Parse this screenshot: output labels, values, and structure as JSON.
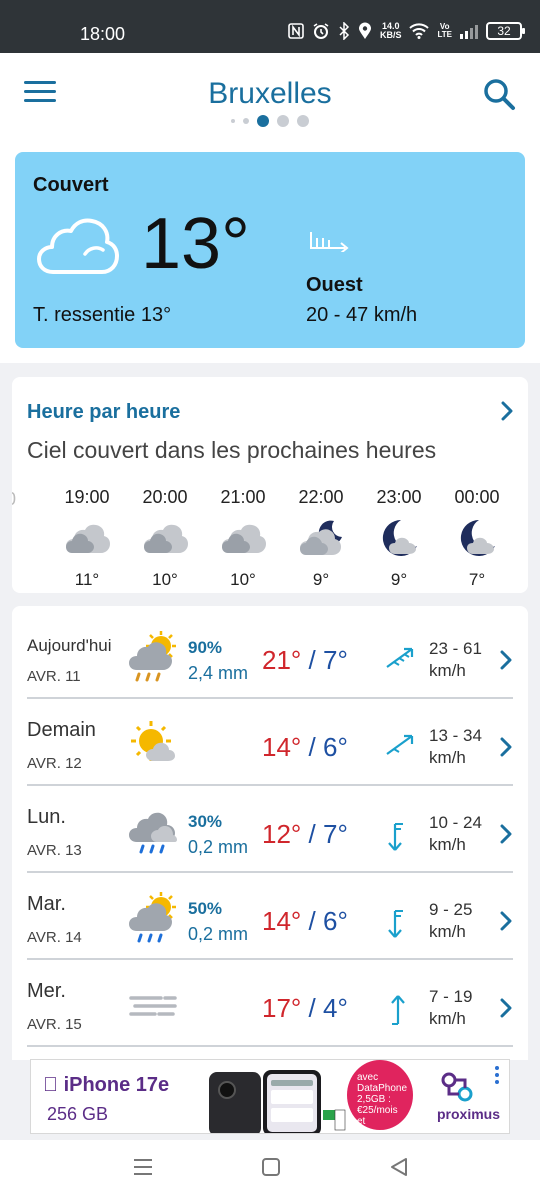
{
  "status_bar": {
    "time": "18:00",
    "icons": [
      "nfc-icon",
      "alarm-icon",
      "bluetooth-icon",
      "location-icon",
      "wifi-icon",
      "signal-icon"
    ],
    "speed_value": "14.0",
    "speed_unit": "KB/S",
    "volte_top": "Vo",
    "volte_bottom": "LTE",
    "battery": "32"
  },
  "header": {
    "city": "Bruxelles",
    "page_dots": 5,
    "active_dot": 2
  },
  "current": {
    "condition": "Couvert",
    "temperature": "13°",
    "feels_like": "T. ressentie 13°",
    "wind_direction": "Ouest",
    "wind_speed": "20 - 47 km/h",
    "card_color": "#82d2f7"
  },
  "hourly": {
    "title": "Heure par heure",
    "description": "Ciel couvert dans les prochaines heures",
    "hours": [
      {
        "time": "19:00",
        "icon": "cloudy-icon",
        "temp": "11°"
      },
      {
        "time": "20:00",
        "icon": "cloudy-icon",
        "temp": "10°"
      },
      {
        "time": "21:00",
        "icon": "cloudy-icon",
        "temp": "10°"
      },
      {
        "time": "22:00",
        "icon": "moon-cloud-icon",
        "temp": "9°"
      },
      {
        "time": "23:00",
        "icon": "moon-cloud-icon",
        "temp": "9°"
      },
      {
        "time": "00:00",
        "icon": "moon-cloud-icon",
        "temp": "7°"
      }
    ]
  },
  "daily": [
    {
      "name": "Aujourd'hui",
      "date": "AVR. 11",
      "icon": "sun-rain-cloud-icon",
      "prob": "90%",
      "mm": "2,4 mm",
      "high": "21°",
      "sep": " / ",
      "low": "7°",
      "wind_icon": "wind-arrow-sw-icon",
      "wind1": "23 - 61",
      "wind2": "km/h"
    },
    {
      "name": "Demain",
      "date": "AVR. 12",
      "icon": "sun-cloud-icon",
      "prob": "",
      "mm": "",
      "high": "14°",
      "sep": " / ",
      "low": "6°",
      "wind_icon": "wind-arrow-sw-icon",
      "wind1": "13 - 34",
      "wind2": "km/h"
    },
    {
      "name": "Lun.",
      "date": "AVR. 13",
      "icon": "rain-cloud-icon",
      "prob": "30%",
      "mm": "0,2 mm",
      "high": "12°",
      "sep": " / ",
      "low": "7°",
      "wind_icon": "wind-arrow-s-icon",
      "wind1": "10 - 24",
      "wind2": "km/h"
    },
    {
      "name": "Mar.",
      "date": "AVR. 14",
      "icon": "sun-rain-cloud-icon",
      "prob": "50%",
      "mm": "0,2 mm",
      "high": "14°",
      "sep": " / ",
      "low": "6°",
      "wind_icon": "wind-arrow-s-icon",
      "wind1": "9 - 25",
      "wind2": "km/h"
    },
    {
      "name": "Mer.",
      "date": "AVR. 15",
      "icon": "fog-icon",
      "prob": "",
      "mm": "",
      "high": "17°",
      "sep": " / ",
      "low": "4°",
      "wind_icon": "wind-arrow-n-icon",
      "wind1": "7 - 19",
      "wind2": "km/h"
    }
  ],
  "ad": {
    "brand": "iPhone 17e",
    "storage": "256 GB",
    "bubble_lines": [
      "avec",
      "DataPhone",
      "2,5GB :",
      "€25/mois",
      "et"
    ],
    "advertiser": "proximus"
  },
  "colors": {
    "accent": "#1a6f9e",
    "high_temp": "#d0262c",
    "low_temp": "#1e50a2"
  }
}
